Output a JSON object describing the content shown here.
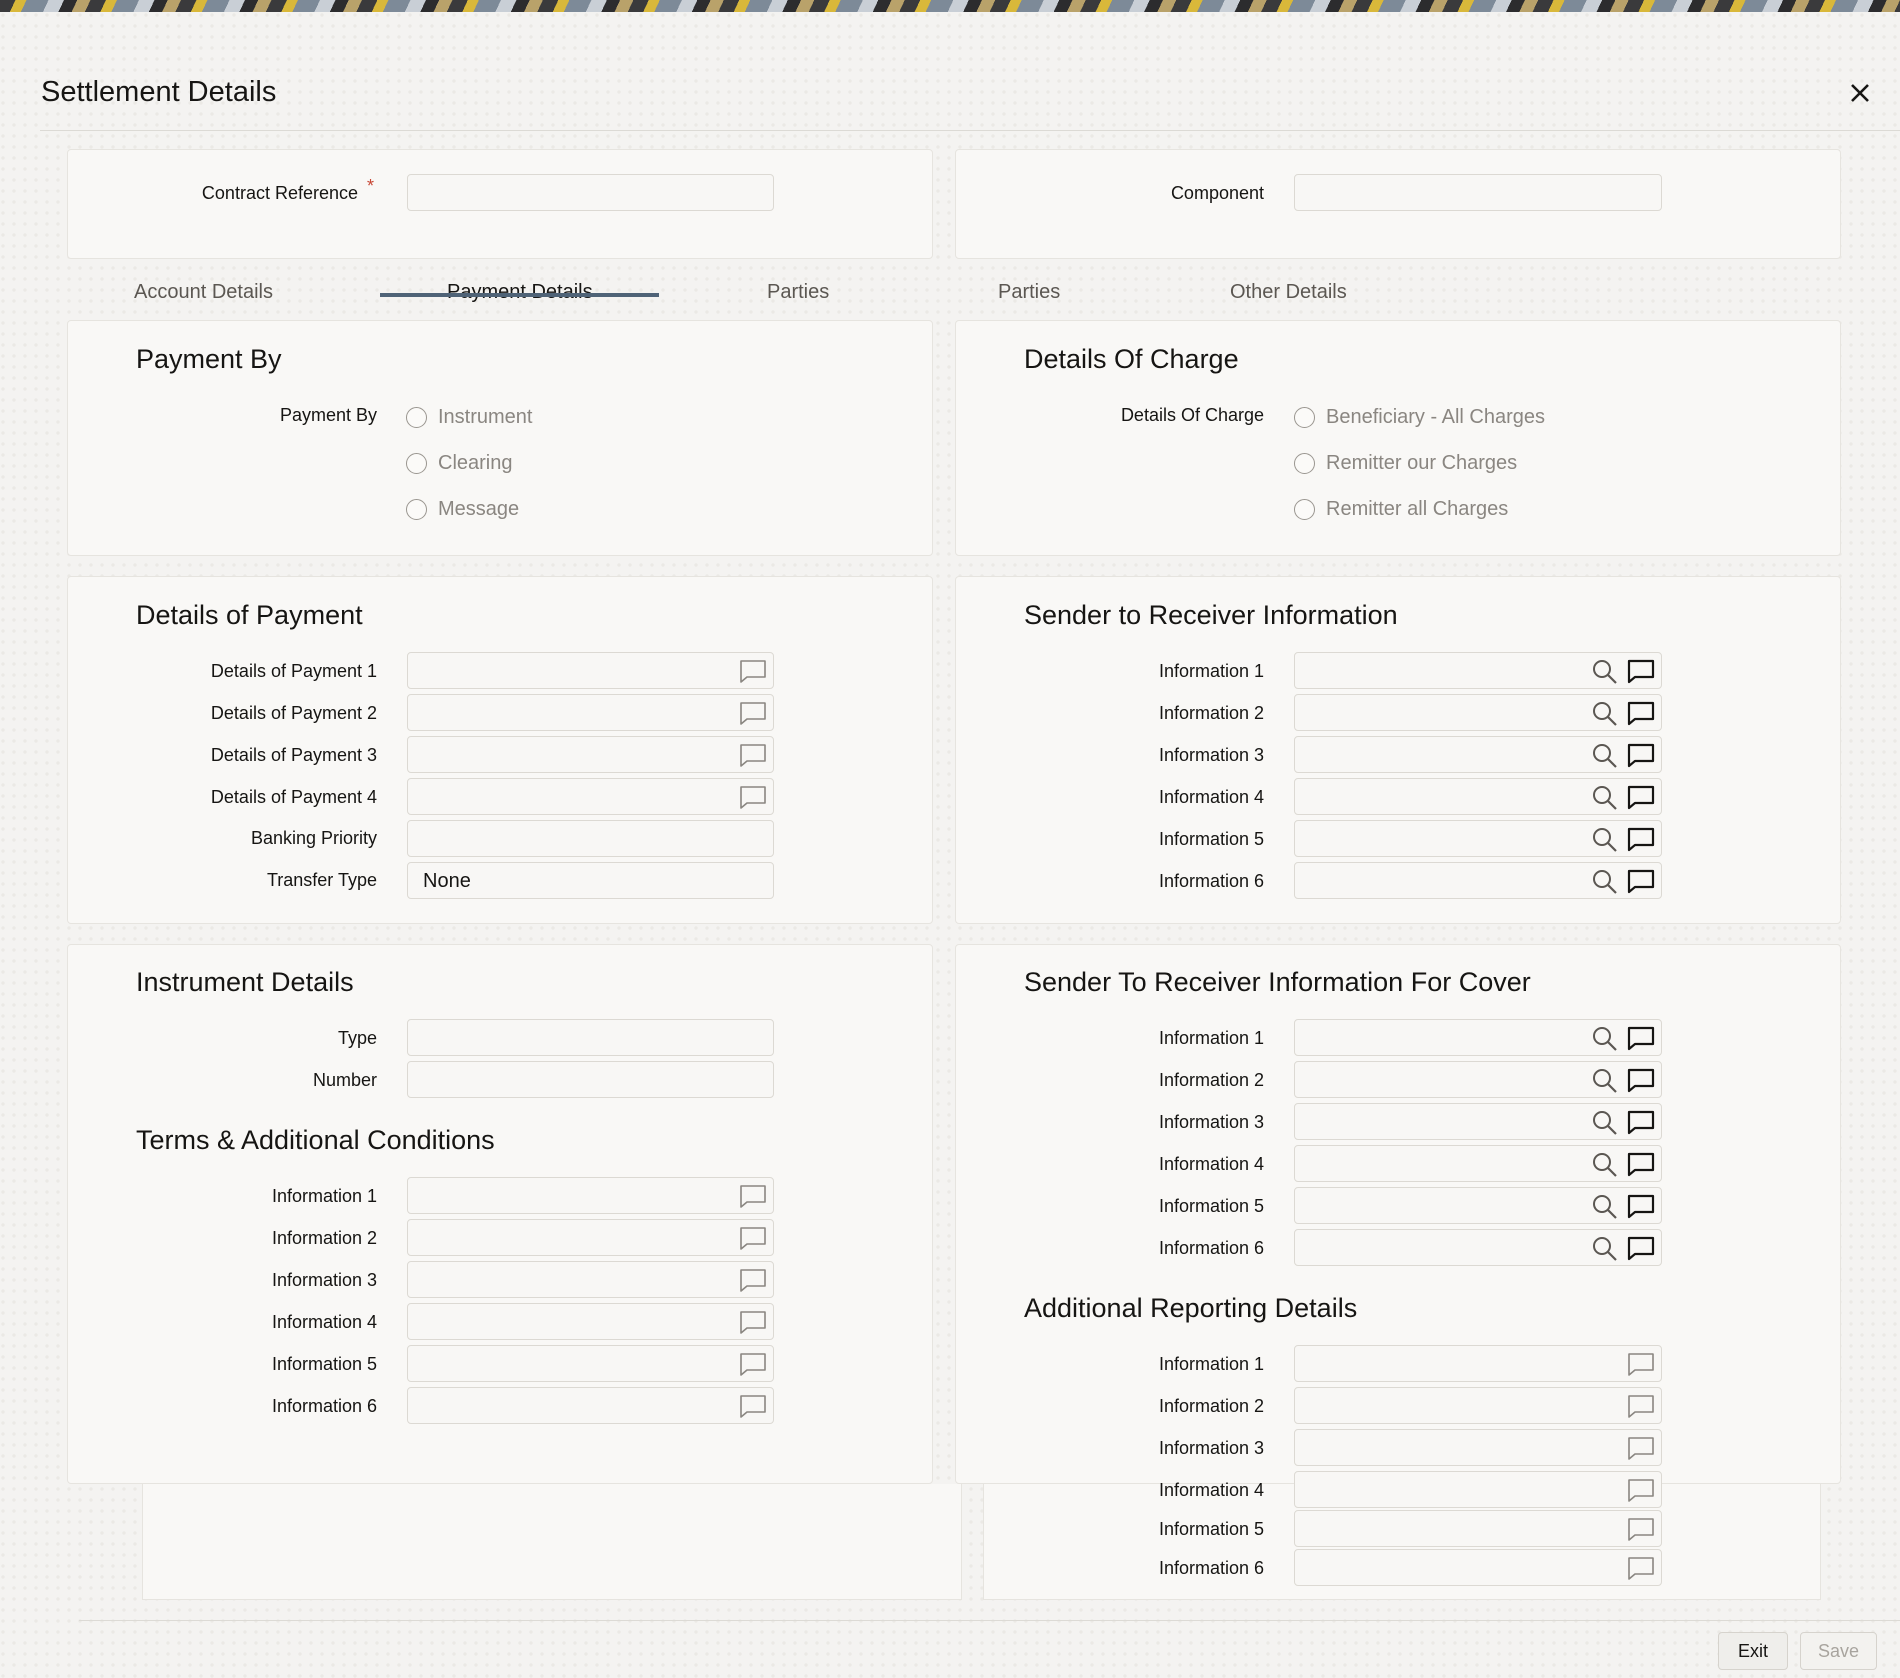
{
  "window": {
    "title": "Settlement Details",
    "close_icon": "close-icon"
  },
  "header_fields": {
    "contract_reference": {
      "label": "Contract Reference",
      "required_mark": "*",
      "value": ""
    },
    "component": {
      "label": "Component",
      "value": ""
    }
  },
  "tabs": [
    {
      "label": "Account Details",
      "active": false
    },
    {
      "label": "Payment Details",
      "active": true
    },
    {
      "label": "Parties",
      "active": false
    },
    {
      "label": "Parties",
      "active": false
    },
    {
      "label": "Other Details",
      "active": false
    }
  ],
  "payment_by": {
    "heading": "Payment By",
    "label": "Payment By",
    "options": [
      "Instrument",
      "Clearing",
      "Message"
    ]
  },
  "details_of_charge": {
    "heading": "Details Of Charge",
    "label": "Details Of Charge",
    "options": [
      "Beneficiary - All Charges",
      "Remitter our Charges",
      "Remitter all Charges"
    ]
  },
  "details_of_payment": {
    "heading": "Details of Payment",
    "fields": [
      {
        "label": "Details of Payment 1",
        "value": ""
      },
      {
        "label": "Details of Payment 2",
        "value": ""
      },
      {
        "label": "Details of Payment 3",
        "value": ""
      },
      {
        "label": "Details of Payment 4",
        "value": ""
      }
    ],
    "banking_priority": {
      "label": "Banking Priority",
      "value": ""
    },
    "transfer_type": {
      "label": "Transfer Type",
      "value": "None"
    }
  },
  "sender_to_receiver": {
    "heading": "Sender to Receiver Information",
    "fields": [
      {
        "label": "Information 1",
        "value": ""
      },
      {
        "label": "Information 2",
        "value": ""
      },
      {
        "label": "Information 3",
        "value": ""
      },
      {
        "label": "Information 4",
        "value": ""
      },
      {
        "label": "Information 5",
        "value": ""
      },
      {
        "label": "Information 6",
        "value": ""
      }
    ]
  },
  "instrument_details": {
    "heading": "Instrument Details",
    "type": {
      "label": "Type",
      "value": ""
    },
    "number": {
      "label": "Number",
      "value": ""
    }
  },
  "terms": {
    "heading": "Terms & Additional Conditions",
    "fields": [
      {
        "label": "Information 1",
        "value": ""
      },
      {
        "label": "Information 2",
        "value": ""
      },
      {
        "label": "Information 3",
        "value": ""
      },
      {
        "label": "Information 4",
        "value": ""
      },
      {
        "label": "Information 5",
        "value": ""
      },
      {
        "label": "Information 6",
        "value": ""
      }
    ]
  },
  "sender_to_receiver_cover": {
    "heading": "Sender To Receiver Information For Cover",
    "fields": [
      {
        "label": "Information 1",
        "value": ""
      },
      {
        "label": "Information 2",
        "value": ""
      },
      {
        "label": "Information 3",
        "value": ""
      },
      {
        "label": "Information 4",
        "value": ""
      },
      {
        "label": "Information 5",
        "value": ""
      },
      {
        "label": "Information 6",
        "value": ""
      }
    ]
  },
  "additional_reporting": {
    "heading": "Additional Reporting Details",
    "fields": [
      {
        "label": "Information 1",
        "value": ""
      },
      {
        "label": "Information 2",
        "value": ""
      },
      {
        "label": "Information 3",
        "value": ""
      },
      {
        "label": "Information 4",
        "value": ""
      },
      {
        "label": "Information 5",
        "value": ""
      },
      {
        "label": "Information 6",
        "value": ""
      }
    ]
  },
  "footer": {
    "exit_label": "Exit",
    "save_label": "Save"
  }
}
